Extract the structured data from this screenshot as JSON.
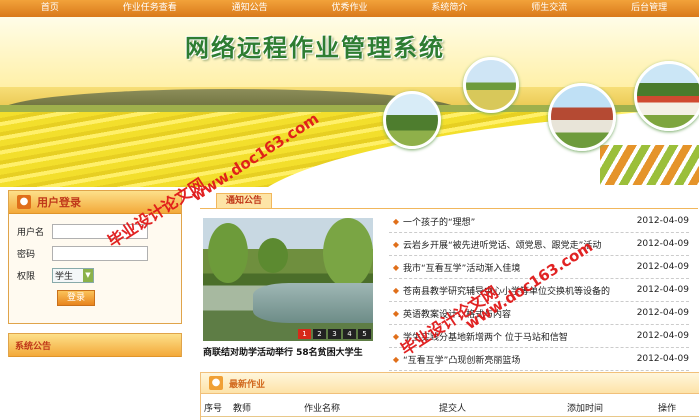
{
  "nav": [
    "首页",
    "作业任务查看",
    "通知公告",
    "优秀作业",
    "系统简介",
    "师生交流",
    "后台管理"
  ],
  "banner": {
    "title": "网络远程作业管理系统"
  },
  "login": {
    "title": "用户登录",
    "username_label": "用户名",
    "password_label": "密码",
    "role_label": "权限",
    "role_value": "学生",
    "submit_label": "登录"
  },
  "system_notice": {
    "title": "系统公告"
  },
  "notice": {
    "tab_label": "通知公告",
    "caption": "商联结对助学活动举行 58名贫困大学生",
    "pager": [
      "1",
      "2",
      "3",
      "4",
      "5"
    ],
    "items": [
      {
        "title": "一个孩子的“理想”",
        "date": "2012-04-09"
      },
      {
        "title": "云岩乡开展“被先进听党话、颂党恩、跟党走”活动",
        "date": "2012-04-09"
      },
      {
        "title": "我市“互看互学”活动渐入佳境",
        "date": "2012-04-09"
      },
      {
        "title": "苍南县教学研究辅导中心小学等单位交换机等设备的",
        "date": "2012-04-09"
      },
      {
        "title": "英语教案设计：格式与内容",
        "date": "2012-04-09"
      },
      {
        "title": "学生实践分基地新增两个 位于马站和信智",
        "date": "2012-04-09"
      },
      {
        "title": "“互看互学”凸现创新亮丽篮场",
        "date": "2012-04-09"
      }
    ]
  },
  "works": {
    "title": "最新作业",
    "columns": [
      "序号",
      "教师",
      "作业名称",
      "提交人",
      "添加时间",
      "操作"
    ]
  },
  "watermarks": [
    "毕业设计论文网",
    "www.doc163.com",
    "毕业设计论文网",
    "www.doc163.com"
  ],
  "colors": {
    "nav": "#e8902a",
    "accent": "#c0391a",
    "title_green": "#2e7d32"
  }
}
